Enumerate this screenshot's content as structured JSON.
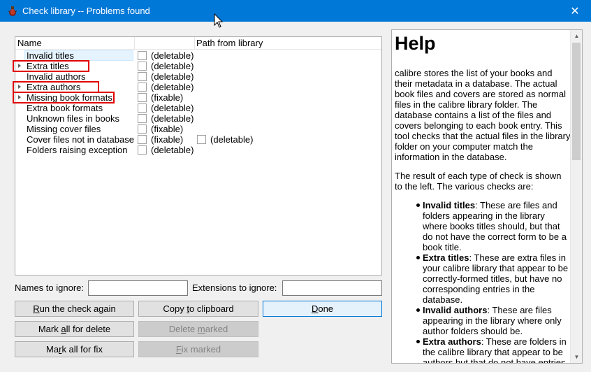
{
  "window": {
    "title": "Check library -- Problems found",
    "close_glyph": "✕"
  },
  "tree": {
    "columns": [
      "Name",
      "Path from library"
    ],
    "rows": [
      {
        "label": "Invalid titles",
        "expandable": false,
        "status": "(deletable)",
        "selected": true
      },
      {
        "label": "Extra titles",
        "expandable": true,
        "status": "(deletable)",
        "highlighted": true
      },
      {
        "label": "Invalid authors",
        "expandable": false,
        "status": "(deletable)"
      },
      {
        "label": "Extra authors",
        "expandable": true,
        "status": "(deletable)",
        "highlighted": true
      },
      {
        "label": "Missing book formats",
        "expandable": true,
        "status": "(fixable)",
        "highlighted": true
      },
      {
        "label": "Extra book formats",
        "expandable": false,
        "status": "(deletable)"
      },
      {
        "label": "Unknown files in books",
        "expandable": false,
        "status": "(deletable)"
      },
      {
        "label": "Missing cover files",
        "expandable": false,
        "status": "(fixable)"
      },
      {
        "label": "Cover files not in database",
        "expandable": false,
        "status": "(fixable)",
        "status2": "(deletable)"
      },
      {
        "label": "Folders raising exception",
        "expandable": false,
        "status": "(deletable)"
      }
    ]
  },
  "filters": {
    "names_label": "Names to ignore:",
    "names_value": "",
    "extensions_label": "Extensions to ignore:",
    "extensions_value": ""
  },
  "buttons": {
    "run_again": {
      "pre": "",
      "u": "R",
      "post": "un the check again"
    },
    "copy": {
      "pre": "Copy ",
      "u": "t",
      "post": "o clipboard"
    },
    "done": {
      "pre": "",
      "u": "D",
      "post": "one"
    },
    "mark_delete": {
      "pre": "Mark ",
      "u": "a",
      "post": "ll for delete"
    },
    "delete_marked": {
      "pre": "Delete ",
      "u": "m",
      "post": "arked"
    },
    "mark_fix": {
      "pre": "Ma",
      "u": "r",
      "post": "k all for fix"
    },
    "fix_marked": {
      "pre": "",
      "u": "F",
      "post": "ix marked"
    }
  },
  "help": {
    "heading": "Help",
    "para1": "calibre stores the list of your books and their metadata in a database. The actual book files and covers are stored as normal files in the calibre library folder. The database contains a list of the files and covers belonging to each book entry. This tool checks that the actual files in the library folder on your computer match the information in the database.",
    "para2": "The result of each type of check is shown to the left. The various checks are:",
    "items": [
      {
        "term": "Invalid titles",
        "desc": ": These are files and folders appearing in the library where books titles should, but that do not have the correct form to be a book title."
      },
      {
        "term": "Extra titles",
        "desc": ": These are extra files in your calibre library that appear to be correctly-formed titles, but have no corresponding entries in the database."
      },
      {
        "term": "Invalid authors",
        "desc": ": These are files appearing in the library where only author folders should be."
      },
      {
        "term": "Extra authors",
        "desc": ": These are folders in the calibre library that appear to be authors but that do not have entries"
      }
    ]
  },
  "colors": {
    "titlebar": "#0078d7",
    "highlight_box": "#e00000",
    "selection": "#e5f3ff"
  }
}
